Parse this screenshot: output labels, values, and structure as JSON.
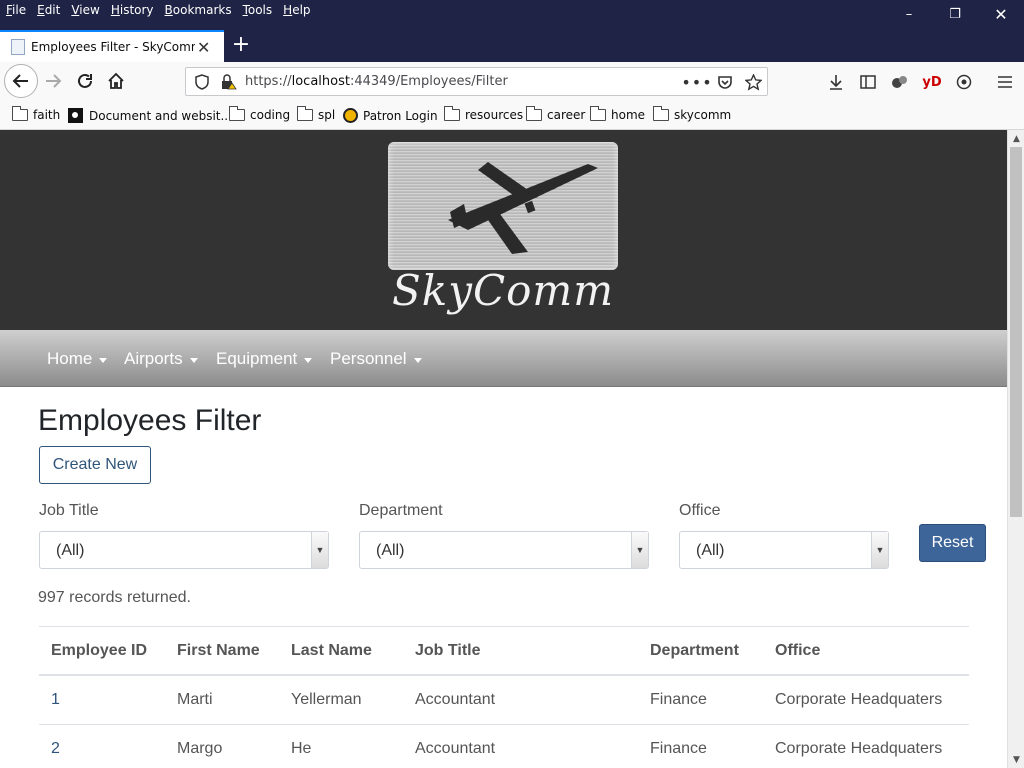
{
  "browser": {
    "menu": [
      "File",
      "Edit",
      "View",
      "History",
      "Bookmarks",
      "Tools",
      "Help"
    ],
    "tab_title": "Employees Filter - SkyComm Portal",
    "url_prefix": "https://",
    "url_host": "localhost",
    "url_rest": ":44349/Employees/Filter",
    "bookmarks": [
      {
        "label": "faith",
        "icon": "folder-icon"
      },
      {
        "label": "Document and websit...",
        "icon": "site-icon"
      },
      {
        "label": "coding",
        "icon": "folder-icon"
      },
      {
        "label": "spl",
        "icon": "folder-icon"
      },
      {
        "label": "Patron Login",
        "icon": "patron-icon"
      },
      {
        "label": "resources",
        "icon": "folder-icon"
      },
      {
        "label": "career",
        "icon": "folder-icon"
      },
      {
        "label": "home",
        "icon": "folder-icon"
      },
      {
        "label": "skycomm",
        "icon": "folder-icon"
      }
    ],
    "toolbar_extension_label": "yD"
  },
  "site": {
    "logo_text": "SkyComm",
    "nav": [
      "Home",
      "Airports",
      "Equipment",
      "Personnel"
    ]
  },
  "page": {
    "title": "Employees Filter",
    "create_label": "Create New",
    "filters": [
      {
        "label": "Job Title",
        "value": "(All)"
      },
      {
        "label": "Department",
        "value": "(All)"
      },
      {
        "label": "Office",
        "value": "(All)"
      }
    ],
    "reset_label": "Reset",
    "records_text": "997 records returned."
  },
  "table": {
    "columns": [
      "Employee ID",
      "First Name",
      "Last Name",
      "Job Title",
      "Department",
      "Office"
    ],
    "rows": [
      [
        "1",
        "Marti",
        "Yellerman",
        "Accountant",
        "Finance",
        "Corporate Headquaters"
      ],
      [
        "2",
        "Margo",
        "He",
        "Accountant",
        "Finance",
        "Corporate Headquaters"
      ]
    ]
  }
}
